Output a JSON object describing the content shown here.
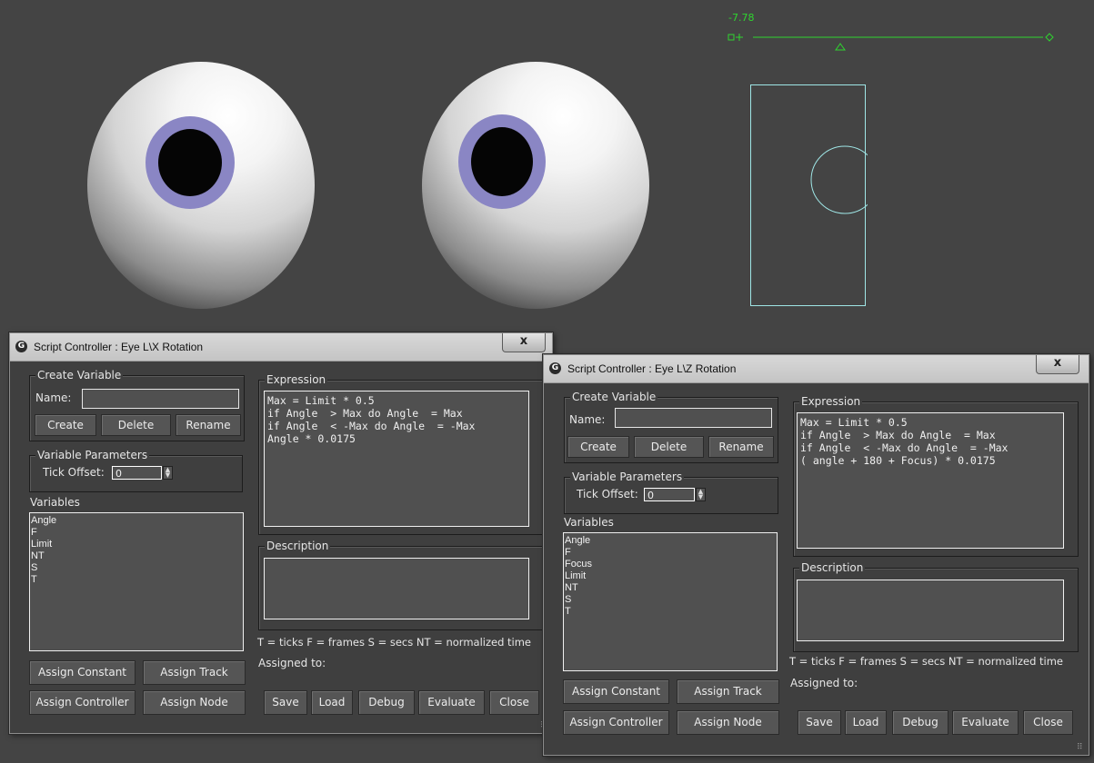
{
  "viewport": {
    "slider": {
      "value_text": "-7.78"
    }
  },
  "dialogs": [
    {
      "title": "Script Controller : Eye L\\X Rotation",
      "close_label": "x",
      "create_variable": {
        "label": "Create Variable",
        "name_label": "Name:",
        "name_value": "",
        "create": "Create",
        "delete": "Delete",
        "rename": "Rename"
      },
      "variable_parameters": {
        "label": "Variable Parameters",
        "tick_offset_label": "Tick Offset:",
        "tick_offset_value": "0"
      },
      "variables_label": "Variables",
      "variables": [
        "Angle",
        "F",
        "Limit",
        "NT",
        "S",
        "T"
      ],
      "expression_label": "Expression",
      "expression": "Max = Limit * 0.5\nif Angle  > Max do Angle  = Max\nif Angle  < -Max do Angle  = -Max\nAngle * 0.0175",
      "description_label": "Description",
      "legend": "T = ticks    F = frames  S = secs  NT = normalized time",
      "assigned_to_label": "Assigned to:",
      "assign_constant": "Assign Constant",
      "assign_track": "Assign Track",
      "assign_controller": "Assign Controller",
      "assign_node": "Assign Node",
      "save": "Save",
      "load": "Load",
      "debug": "Debug",
      "evaluate": "Evaluate",
      "close": "Close"
    },
    {
      "title": "Script Controller : Eye L\\Z Rotation",
      "close_label": "x",
      "create_variable": {
        "label": "Create Variable",
        "name_label": "Name:",
        "name_value": "",
        "create": "Create",
        "delete": "Delete",
        "rename": "Rename"
      },
      "variable_parameters": {
        "label": "Variable Parameters",
        "tick_offset_label": "Tick Offset:",
        "tick_offset_value": "0"
      },
      "variables_label": "Variables",
      "variables": [
        "Angle",
        "F",
        "Focus",
        "Limit",
        "NT",
        "S",
        "T"
      ],
      "expression_label": "Expression",
      "expression": "Max = Limit * 0.5\nif Angle  > Max do Angle  = Max\nif Angle  < -Max do Angle  = -Max\n( angle + 180 + Focus) * 0.0175",
      "description_label": "Description",
      "legend": "T = ticks    F = frames  S = secs  NT = normalized time",
      "assigned_to_label": "Assigned to:",
      "assign_constant": "Assign Constant",
      "assign_track": "Assign Track",
      "assign_controller": "Assign Controller",
      "assign_node": "Assign Node",
      "save": "Save",
      "load": "Load",
      "debug": "Debug",
      "evaluate": "Evaluate",
      "close": "Close"
    }
  ]
}
